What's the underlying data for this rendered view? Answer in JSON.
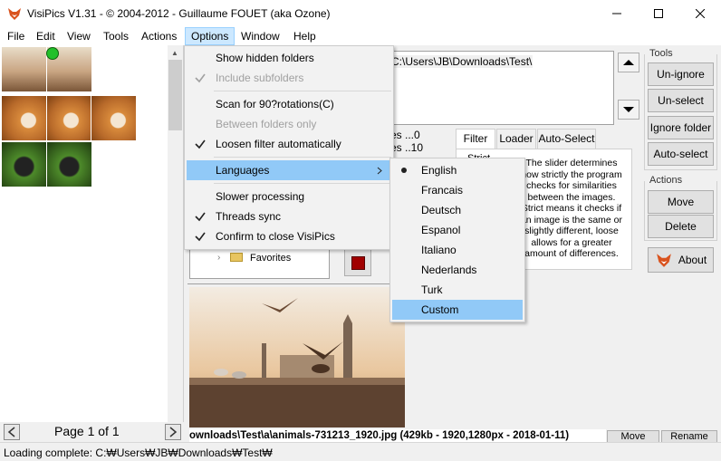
{
  "window": {
    "title": "VisiPics V1.31 - © 2004-2012 - Guillaume FOUET (aka Ozone)"
  },
  "menubar": [
    "File",
    "Edit",
    "View",
    "Tools",
    "Actions",
    "Options",
    "Window",
    "Help"
  ],
  "options_menu": {
    "items": [
      {
        "label": "Show hidden folders",
        "checked": false,
        "disabled": false
      },
      {
        "label": "Include subfolders",
        "checked": true,
        "disabled": true
      },
      {
        "label": "Scan for 90?rotations(C)",
        "checked": false,
        "disabled": false
      },
      {
        "label": "Between folders only",
        "checked": false,
        "disabled": true
      },
      {
        "label": "Loosen filter automatically",
        "checked": true,
        "disabled": false
      },
      {
        "label": "Languages",
        "checked": false,
        "disabled": false,
        "submenu": true
      },
      {
        "label": "Slower processing",
        "checked": false,
        "disabled": false
      },
      {
        "label": "Threads sync",
        "checked": true,
        "disabled": false
      },
      {
        "label": "Confirm to close VisiPics",
        "checked": true,
        "disabled": false
      }
    ]
  },
  "languages_menu": {
    "items": [
      "English",
      "Francais",
      "Deutsch",
      "Espanol",
      "Italiano",
      "Nederlands",
      "Turk",
      "Custom"
    ],
    "selected": "English",
    "highlighted": "Custom"
  },
  "path_box": {
    "path": "C:\\Users\\JB\\Downloads\\Test\\"
  },
  "partial_labels": {
    "line1": "es ...0",
    "line2": "es ..10",
    "tree_item": "Favorites"
  },
  "tools_panel": {
    "label": "Tools",
    "buttons": [
      "Un-ignore",
      "Un-select",
      "Ignore folder",
      "Auto-select"
    ]
  },
  "actions_panel": {
    "label": "Actions",
    "buttons": [
      "Move",
      "Delete"
    ],
    "about": "About"
  },
  "filter_tabs": [
    "Filter",
    "Loader",
    "Auto-Select"
  ],
  "filter": {
    "level_label": "Strict",
    "description": "The slider determines how strictly the program checks for similarities between the images. Strict means it checks if an image is the same or slightly different, loose allows for a greater amount of differences."
  },
  "pager": {
    "label": "Page 1 of 1"
  },
  "file_info": {
    "text": "ownloads\\Test\\a\\animals-731213_1920.jpg (429kb - 1920,1280px - 2018-01-11)",
    "move": "Move",
    "rename": "Rename"
  },
  "status": {
    "text": "Loading complete: C:₩Users₩JB₩Downloads₩Test₩"
  },
  "colors": {
    "menu_highlight": "#91c9f7",
    "open_menu": "#cce8ff",
    "stop_red": "#a00000"
  },
  "icons": [
    "fox-app-icon",
    "minimize-icon",
    "maximize-icon",
    "close-icon",
    "green-dot-icon",
    "submenu-arrow-icon",
    "check-icon",
    "radio-bullet-icon",
    "arrow-up-icon",
    "arrow-down-icon",
    "fox-about-icon",
    "page-prev-icon",
    "page-next-icon"
  ]
}
